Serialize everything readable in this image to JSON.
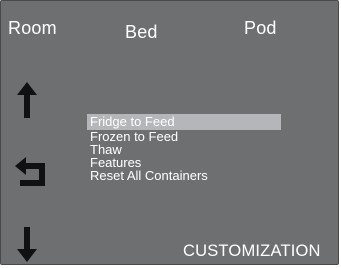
{
  "tabs": {
    "room": "Room",
    "bed": "Bed",
    "pod": "Pod"
  },
  "nav": {
    "up_icon": "arrow-up-icon",
    "back_icon": "back-arrow-icon",
    "down_icon": "arrow-down-icon"
  },
  "menu": {
    "items": [
      "Fridge to Feed",
      "Frozen to Feed",
      "Thaw",
      "Features",
      "Reset All Containers"
    ],
    "selected_index": 0
  },
  "screen_title": "CUSTOMIZATION",
  "colors": {
    "background": "#6e6f71",
    "highlight": "#b5b6b9",
    "text": "#ffffff",
    "icon": "#111111"
  }
}
